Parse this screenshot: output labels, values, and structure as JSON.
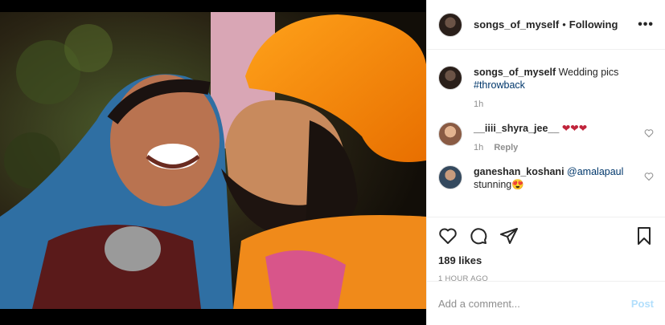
{
  "header": {
    "username": "songs_of_myself",
    "separator": "•",
    "follow_status": "Following",
    "more_label": "•••"
  },
  "caption": {
    "username": "songs_of_myself",
    "text": "Wedding pics",
    "hashtag": "#throwback",
    "time": "1h"
  },
  "comments": [
    {
      "username": "__iiii_shyra_jee__",
      "text": "❤❤❤",
      "time": "1h",
      "reply_label": "Reply"
    },
    {
      "username": "ganeshan_koshani",
      "mention": "@amalapaul",
      "text": "stunning😍"
    }
  ],
  "likes": "189 likes",
  "posted_ago": "1 HOUR AGO",
  "add_comment": {
    "placeholder": "Add a comment...",
    "post_label": "Post"
  },
  "icons": {
    "more": "more-icon",
    "like": "heart-icon",
    "comment": "comment-icon",
    "share": "share-icon",
    "save": "bookmark-icon"
  },
  "colors": {
    "link": "#00376b",
    "post_disabled": "#b2dffc",
    "meta": "#8e8e8e"
  }
}
